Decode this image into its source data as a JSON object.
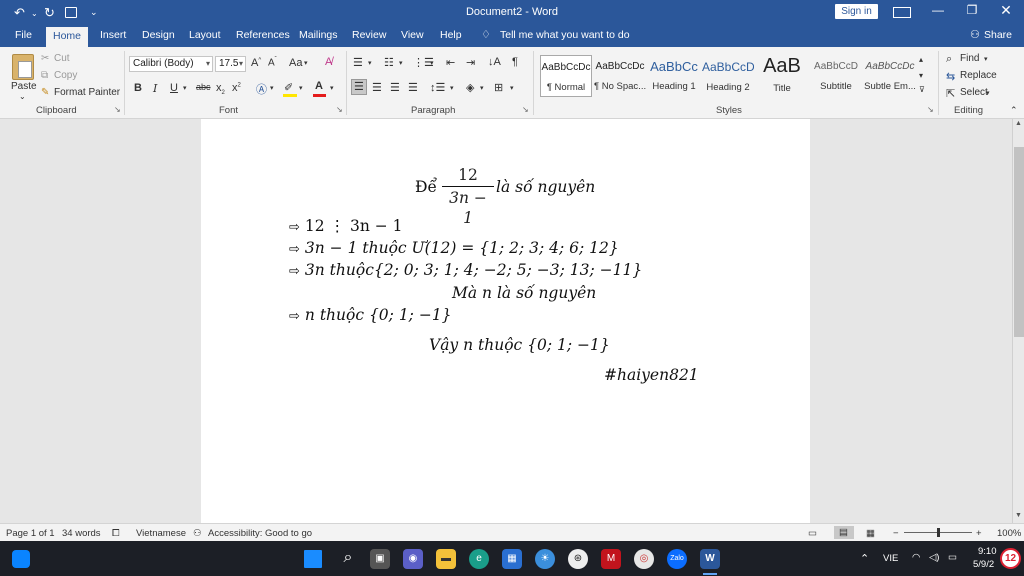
{
  "window": {
    "title": "Document2 - Word",
    "signin_label": "Sign in"
  },
  "tabs": [
    "File",
    "Home",
    "Insert",
    "Design",
    "Layout",
    "References",
    "Mailings",
    "Review",
    "View",
    "Help"
  ],
  "tellme": "Tell me what you want to do",
  "share_label": "Share",
  "clipboard": {
    "paste": "Paste",
    "cut": "Cut",
    "copy": "Copy",
    "format_painter": "Format Painter",
    "group": "Clipboard"
  },
  "font": {
    "name": "Calibri (Body)",
    "size": "17.5",
    "group": "Font",
    "change_case": "Aa"
  },
  "paragraph": {
    "group": "Paragraph"
  },
  "styles": {
    "group": "Styles",
    "items": [
      {
        "sample": "AaBbCcDc",
        "name": "¶ Normal"
      },
      {
        "sample": "AaBbCcDc",
        "name": "¶ No Spac..."
      },
      {
        "sample": "AaBbCc",
        "name": "Heading 1"
      },
      {
        "sample": "AaBbCcD",
        "name": "Heading 2"
      },
      {
        "sample": "AaB",
        "name": "Title"
      },
      {
        "sample": "AaBbCcD",
        "name": "Subtitle"
      },
      {
        "sample": "AaBbCcDc",
        "name": "Subtle Em..."
      }
    ]
  },
  "editing": {
    "find": "Find",
    "replace": "Replace",
    "select": "Select",
    "group": "Editing"
  },
  "doc": {
    "line1_prefix": "Để",
    "frac_num": "12",
    "frac_den": "3n − 1",
    "line1_suffix": "là số nguyên",
    "line2": "12 ⋮ 3n − 1",
    "line3": "3n − 1 thuộc Ư(12) = {1; 2; 3; 4; 6; 12}",
    "line4": "3n thuộc{2; 0; 3; 1; 4;  −2; 5;  −3; 13;  −11}",
    "line5": "Mà n là số nguyên",
    "line6": "n thuộc {0; 1;  −1}",
    "line7": "Vậy n thuộc {0; 1;  −1}",
    "line8": "#haiyen821"
  },
  "status": {
    "page": "Page 1 of 1",
    "words": "34 words",
    "language": "Vietnamese",
    "accessibility": "Accessibility: Good to go",
    "zoom": "100%"
  },
  "taskbar": {
    "lang": "VIE",
    "time": "9:10",
    "date": "5/9/2",
    "badge": "12"
  }
}
